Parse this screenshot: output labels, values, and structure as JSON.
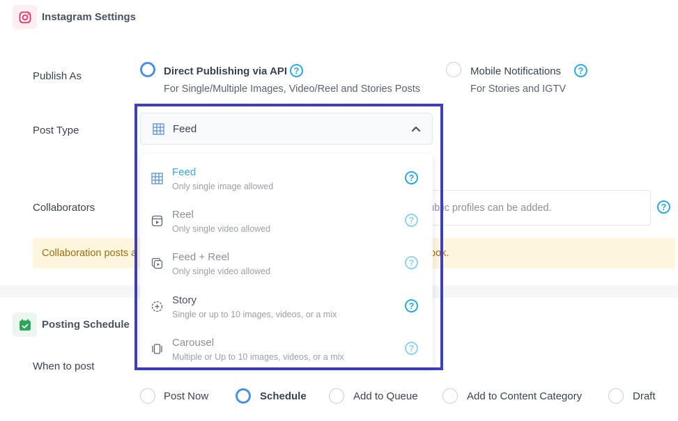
{
  "instagram_section": {
    "title": "Instagram Settings"
  },
  "publish_as": {
    "label": "Publish As",
    "options": [
      {
        "title": "Direct Publishing via API",
        "subtitle": "For Single/Multiple Images, Video/Reel and Stories Posts",
        "selected": true
      },
      {
        "title": "Mobile Notifications",
        "subtitle": "For Stories and IGTV",
        "selected": false
      }
    ]
  },
  "post_type": {
    "label": "Post Type",
    "selected": "Feed",
    "options": [
      {
        "name": "Feed",
        "desc": "Only single image allowed",
        "icon": "grid-icon"
      },
      {
        "name": "Reel",
        "desc": "Only single video allowed",
        "icon": "reel-icon"
      },
      {
        "name": "Feed + Reel",
        "desc": "Only single video allowed",
        "icon": "feed-reel-icon"
      },
      {
        "name": "Story",
        "desc": "Single or up to 10 images, videos, or a mix",
        "icon": "story-icon"
      },
      {
        "name": "Carousel",
        "desc": "Multiple or Up to 10 images, videos, or a mix",
        "icon": "carousel-icon"
      }
    ]
  },
  "collaborators": {
    "label": "Collaborators",
    "placeholder_visible": "ublic profiles can be added."
  },
  "notice": {
    "text_left": "Collaboration posts a",
    "text_right": "ook."
  },
  "posting_schedule": {
    "title": "Posting Schedule",
    "when_label": "When to post",
    "options": [
      {
        "label": "Post Now",
        "selected": false
      },
      {
        "label": "Schedule",
        "selected": true
      },
      {
        "label": "Add to Queue",
        "selected": false
      },
      {
        "label": "Add to Content Category",
        "selected": false
      },
      {
        "label": "Draft",
        "selected": false
      }
    ]
  },
  "colors": {
    "accent": "#4a8fe7",
    "help": "#27a9e5",
    "highlight_frame": "#3d3ec4",
    "notice_bg": "#fdf5dc"
  }
}
